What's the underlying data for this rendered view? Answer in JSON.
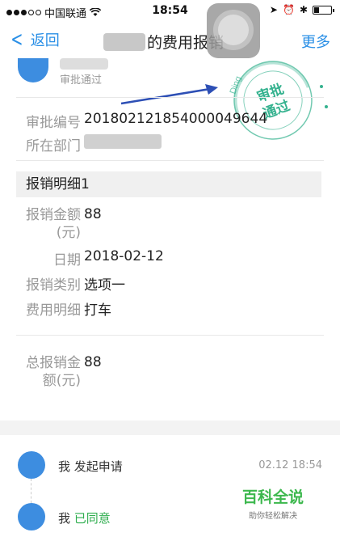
{
  "status_bar": {
    "carrier": "中国联通",
    "time": "18:54",
    "wifi_icon": "wifi-icon"
  },
  "nav": {
    "back_label": "返回",
    "title": "的费用报销",
    "more_label": "更多"
  },
  "applicant": {
    "status": "审批通过"
  },
  "stamp": {
    "text_line1": "审批",
    "text_line2": "通过",
    "ring_text": "Ding",
    "color": "#35b28f"
  },
  "info": {
    "approval_no_label": "审批编号",
    "approval_no": "201802121854000049644",
    "department_label": "所在部门"
  },
  "detail": {
    "section_title": "报销明细1",
    "amount_label_line1": "报销金额",
    "amount_label_line2": "(元)",
    "amount": "88",
    "date_label": "日期",
    "date": "2018-02-12",
    "category_label": "报销类别",
    "category": "选项一",
    "expense_detail_label": "费用明细",
    "expense_detail": "打车"
  },
  "total": {
    "label_line1": "总报销金",
    "label_line2": "额(元)",
    "value": "88",
    "value_color": "#e8453c"
  },
  "timeline": [
    {
      "actor": "我",
      "action": "发起申请",
      "time": "02.12 18:54"
    },
    {
      "actor": "我",
      "action": "已同意",
      "time": ""
    }
  ],
  "watermark": {
    "title": "百科全说",
    "subtitle": "助你轻松解决"
  },
  "colors": {
    "accent": "#2a8fe6",
    "approved_green": "#2fae4f"
  }
}
